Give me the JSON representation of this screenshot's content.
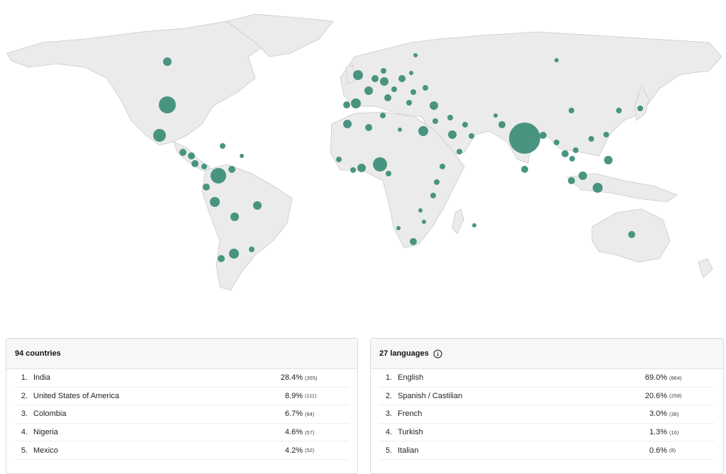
{
  "colors": {
    "bubble": "#3f8f7a",
    "land": "#ebebeb",
    "panel_header": "#f7f7f8"
  },
  "countries": {
    "title": "94 countries",
    "rows": [
      {
        "rank": "1.",
        "name": "India",
        "pct": "28.4%",
        "count": "(355)"
      },
      {
        "rank": "2.",
        "name": "United States of America",
        "pct": "8.9%",
        "count": "(111)"
      },
      {
        "rank": "3.",
        "name": "Colombia",
        "pct": "6.7%",
        "count": "(84)"
      },
      {
        "rank": "4.",
        "name": "Nigeria",
        "pct": "4.6%",
        "count": "(57)"
      },
      {
        "rank": "5.",
        "name": "Mexico",
        "pct": "4.2%",
        "count": "(52)"
      }
    ]
  },
  "languages": {
    "title": "27 languages",
    "info_icon": "info-icon",
    "rows": [
      {
        "rank": "1.",
        "name": "English",
        "pct": "69.0%",
        "count": "(864)"
      },
      {
        "rank": "2.",
        "name": "Spanish / Castilian",
        "pct": "20.6%",
        "count": "(258)"
      },
      {
        "rank": "3.",
        "name": "French",
        "pct": "3.0%",
        "count": "(38)"
      },
      {
        "rank": "4.",
        "name": "Turkish",
        "pct": "1.3%",
        "count": "(16)"
      },
      {
        "rank": "5.",
        "name": "Italian",
        "pct": "0.6%",
        "count": "(8)"
      }
    ]
  }
}
